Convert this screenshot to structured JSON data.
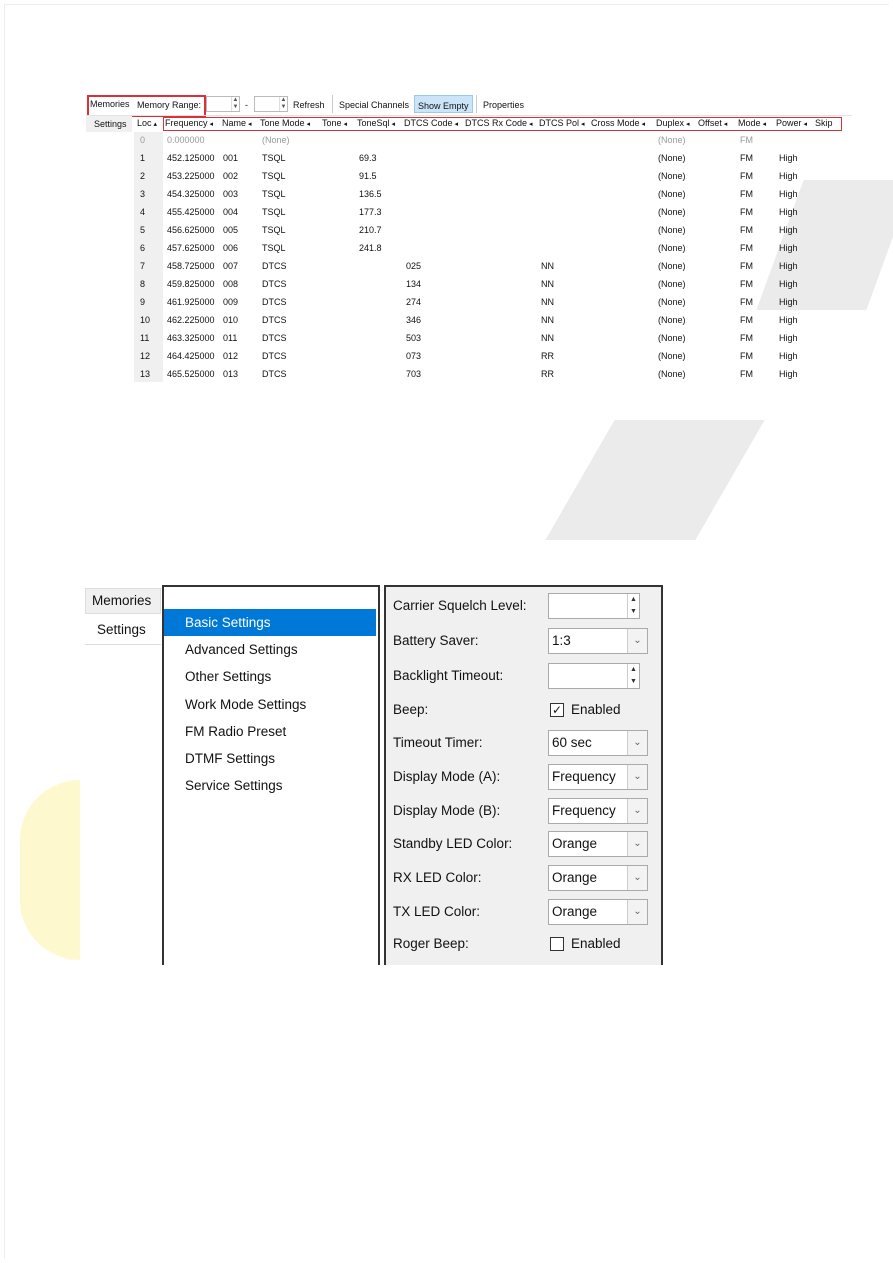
{
  "memories_window": {
    "tabs": [
      "Memories",
      "Settings"
    ],
    "toolbar": {
      "memory_range_label": "Memory Range:",
      "range_start": "",
      "range_end": "",
      "dash": "-",
      "refresh": "Refresh",
      "special_channels": "Special Channels",
      "show_empty": "Show Empty",
      "properties": "Properties"
    },
    "columns": [
      "Loc",
      "Frequency",
      "Name",
      "Tone Mode",
      "Tone",
      "ToneSql",
      "DTCS Code",
      "DTCS Rx Code",
      "DTCS Pol",
      "Cross Mode",
      "Duplex",
      "Offset",
      "Mode",
      "Power",
      "Skip"
    ],
    "rows": [
      {
        "loc": "0",
        "freq": "0.000000",
        "name": "",
        "tonemode": "(None)",
        "tonesql": "",
        "dtcs": "",
        "pol": "",
        "duplex": "(None)",
        "mode": "FM",
        "power": "",
        "empty": true
      },
      {
        "loc": "1",
        "freq": "452.125000",
        "name": "001",
        "tonemode": "TSQL",
        "tonesql": "69.3",
        "dtcs": "",
        "pol": "",
        "duplex": "(None)",
        "mode": "FM",
        "power": "High"
      },
      {
        "loc": "2",
        "freq": "453.225000",
        "name": "002",
        "tonemode": "TSQL",
        "tonesql": "91.5",
        "dtcs": "",
        "pol": "",
        "duplex": "(None)",
        "mode": "FM",
        "power": "High"
      },
      {
        "loc": "3",
        "freq": "454.325000",
        "name": "003",
        "tonemode": "TSQL",
        "tonesql": "136.5",
        "dtcs": "",
        "pol": "",
        "duplex": "(None)",
        "mode": "FM",
        "power": "High"
      },
      {
        "loc": "4",
        "freq": "455.425000",
        "name": "004",
        "tonemode": "TSQL",
        "tonesql": "177.3",
        "dtcs": "",
        "pol": "",
        "duplex": "(None)",
        "mode": "FM",
        "power": "High"
      },
      {
        "loc": "5",
        "freq": "456.625000",
        "name": "005",
        "tonemode": "TSQL",
        "tonesql": "210.7",
        "dtcs": "",
        "pol": "",
        "duplex": "(None)",
        "mode": "FM",
        "power": "High"
      },
      {
        "loc": "6",
        "freq": "457.625000",
        "name": "006",
        "tonemode": "TSQL",
        "tonesql": "241.8",
        "dtcs": "",
        "pol": "",
        "duplex": "(None)",
        "mode": "FM",
        "power": "High"
      },
      {
        "loc": "7",
        "freq": "458.725000",
        "name": "007",
        "tonemode": "DTCS",
        "tonesql": "",
        "dtcs": "025",
        "pol": "NN",
        "duplex": "(None)",
        "mode": "FM",
        "power": "High"
      },
      {
        "loc": "8",
        "freq": "459.825000",
        "name": "008",
        "tonemode": "DTCS",
        "tonesql": "",
        "dtcs": "134",
        "pol": "NN",
        "duplex": "(None)",
        "mode": "FM",
        "power": "High"
      },
      {
        "loc": "9",
        "freq": "461.925000",
        "name": "009",
        "tonemode": "DTCS",
        "tonesql": "",
        "dtcs": "274",
        "pol": "NN",
        "duplex": "(None)",
        "mode": "FM",
        "power": "High"
      },
      {
        "loc": "10",
        "freq": "462.225000",
        "name": "010",
        "tonemode": "DTCS",
        "tonesql": "",
        "dtcs": "346",
        "pol": "NN",
        "duplex": "(None)",
        "mode": "FM",
        "power": "High"
      },
      {
        "loc": "11",
        "freq": "463.325000",
        "name": "011",
        "tonemode": "DTCS",
        "tonesql": "",
        "dtcs": "503",
        "pol": "NN",
        "duplex": "(None)",
        "mode": "FM",
        "power": "High"
      },
      {
        "loc": "12",
        "freq": "464.425000",
        "name": "012",
        "tonemode": "DTCS",
        "tonesql": "",
        "dtcs": "073",
        "pol": "RR",
        "duplex": "(None)",
        "mode": "FM",
        "power": "High"
      },
      {
        "loc": "13",
        "freq": "465.525000",
        "name": "013",
        "tonemode": "DTCS",
        "tonesql": "",
        "dtcs": "703",
        "pol": "RR",
        "duplex": "(None)",
        "mode": "FM",
        "power": "High"
      }
    ]
  },
  "settings_window": {
    "tabs": [
      "Memories",
      "Settings"
    ],
    "nav": [
      "Basic Settings",
      "Advanced Settings",
      "Other Settings",
      "Work Mode Settings",
      "FM Radio Preset",
      "DTMF Settings",
      "Service Settings"
    ],
    "selected_nav": "Basic Settings",
    "fields": [
      {
        "label": "Carrier Squelch Level:",
        "type": "spin",
        "value": ""
      },
      {
        "label": "Battery Saver:",
        "type": "select",
        "value": "1:3"
      },
      {
        "label": "Backlight Timeout:",
        "type": "spin",
        "value": ""
      },
      {
        "label": "Beep:",
        "type": "check",
        "value": "Enabled",
        "checked": true
      },
      {
        "label": "Timeout Timer:",
        "type": "select",
        "value": "60 sec"
      },
      {
        "label": "Display Mode (A):",
        "type": "select",
        "value": "Frequency"
      },
      {
        "label": "Display Mode (B):",
        "type": "select",
        "value": "Frequency"
      },
      {
        "label": "Standby LED Color:",
        "type": "select",
        "value": "Orange"
      },
      {
        "label": "RX LED Color:",
        "type": "select",
        "value": "Orange"
      },
      {
        "label": "TX LED Color:",
        "type": "select",
        "value": "Orange"
      },
      {
        "label": "Roger Beep:",
        "type": "check",
        "value": "Enabled",
        "checked": false
      }
    ]
  },
  "colors": {
    "highlight_red": "#d9303a",
    "selected_blue": "#0078d7",
    "show_empty_bg": "#cce4f7"
  }
}
